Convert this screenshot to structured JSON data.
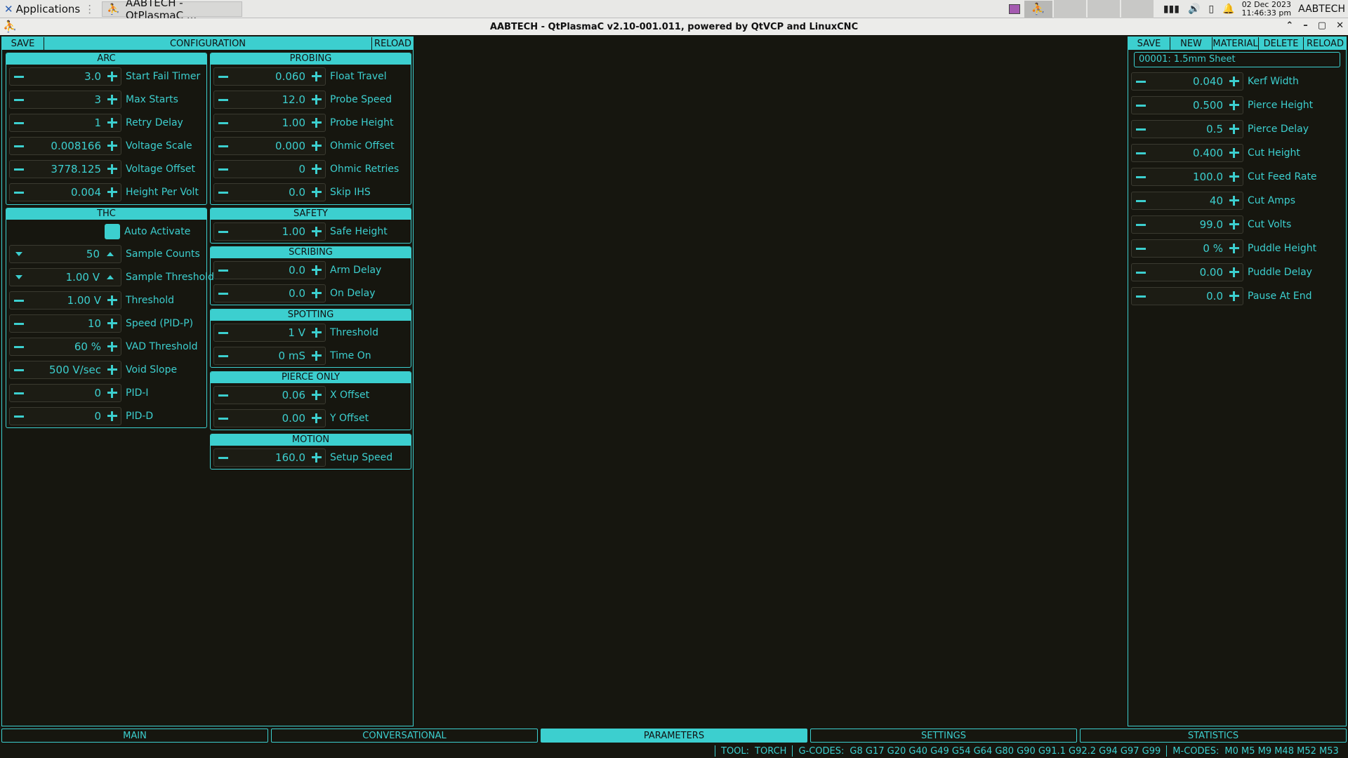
{
  "taskbar": {
    "applications": "Applications",
    "window_title": "AABTECH - QtPlasmaC ...",
    "date": "02 Dec 2023",
    "time": "11:46:33 pm",
    "user": "AABTECH"
  },
  "window": {
    "title": "AABTECH - QtPlasmaC v2.10-001.011, powered by QtVCP and LinuxCNC"
  },
  "config": {
    "save": "SAVE",
    "title": "CONFIGURATION",
    "reload": "RELOAD",
    "arc": {
      "title": "ARC",
      "rows": [
        {
          "value": "3.0",
          "label": "Start Fail Timer"
        },
        {
          "value": "3",
          "label": "Max Starts"
        },
        {
          "value": "1",
          "label": "Retry Delay"
        },
        {
          "value": "0.008166",
          "label": "Voltage Scale"
        },
        {
          "value": "3778.125",
          "label": "Voltage Offset"
        },
        {
          "value": "0.004",
          "label": "Height Per Volt"
        }
      ]
    },
    "thc": {
      "title": "THC",
      "auto_activate": "Auto Activate",
      "rows": [
        {
          "value": "50",
          "label": "Sample Counts"
        },
        {
          "value": "1.00 V",
          "label": "Sample Threshold"
        },
        {
          "value": "1.00 V",
          "label": "Threshold"
        },
        {
          "value": "10",
          "label": "Speed (PID-P)"
        },
        {
          "value": "60 %",
          "label": "VAD Threshold"
        },
        {
          "value": "500 V/sec",
          "label": "Void Slope"
        },
        {
          "value": "0",
          "label": "PID-I"
        },
        {
          "value": "0",
          "label": "PID-D"
        }
      ]
    },
    "probing": {
      "title": "PROBING",
      "rows": [
        {
          "value": "0.060",
          "label": "Float Travel"
        },
        {
          "value": "12.0",
          "label": "Probe Speed"
        },
        {
          "value": "1.00",
          "label": "Probe Height"
        },
        {
          "value": "0.000",
          "label": "Ohmic Offset"
        },
        {
          "value": "0",
          "label": "Ohmic Retries"
        },
        {
          "value": "0.0",
          "label": "Skip IHS"
        }
      ]
    },
    "safety": {
      "title": "SAFETY",
      "rows": [
        {
          "value": "1.00",
          "label": "Safe Height"
        }
      ]
    },
    "scribing": {
      "title": "SCRIBING",
      "rows": [
        {
          "value": "0.0",
          "label": "Arm Delay"
        },
        {
          "value": "0.0",
          "label": "On Delay"
        }
      ]
    },
    "spotting": {
      "title": "SPOTTING",
      "rows": [
        {
          "value": "1 V",
          "label": "Threshold"
        },
        {
          "value": "0 mS",
          "label": "Time On"
        }
      ]
    },
    "pierce_only": {
      "title": "PIERCE ONLY",
      "rows": [
        {
          "value": "0.06",
          "label": "X Offset"
        },
        {
          "value": "0.00",
          "label": "Y Offset"
        }
      ]
    },
    "motion": {
      "title": "MOTION",
      "rows": [
        {
          "value": "160.0",
          "label": "Setup Speed"
        }
      ]
    }
  },
  "material": {
    "save": "SAVE",
    "new": "NEW",
    "material": "MATERIAL",
    "delete": "DELETE",
    "reload": "RELOAD",
    "selected": "00001: 1.5mm Sheet",
    "rows": [
      {
        "value": "0.040",
        "label": "Kerf Width"
      },
      {
        "value": "0.500",
        "label": "Pierce Height"
      },
      {
        "value": "0.5",
        "label": "Pierce Delay"
      },
      {
        "value": "0.400",
        "label": "Cut Height"
      },
      {
        "value": "100.0",
        "label": "Cut Feed Rate"
      },
      {
        "value": "40",
        "label": "Cut Amps"
      },
      {
        "value": "99.0",
        "label": "Cut Volts"
      },
      {
        "value": "0 %",
        "label": "Puddle Height"
      },
      {
        "value": "0.00",
        "label": "Puddle Delay"
      },
      {
        "value": "0.0",
        "label": "Pause At End"
      }
    ]
  },
  "tabs": [
    "MAIN",
    "CONVERSATIONAL",
    "PARAMETERS",
    "SETTINGS",
    "STATISTICS"
  ],
  "status": {
    "tool_label": "TOOL:",
    "tool": "TORCH",
    "gcodes_label": "G-CODES:",
    "gcodes": "G8 G17 G20 G40 G49 G54 G64 G80 G90 G91.1 G92.2 G94 G97 G99",
    "mcodes_label": "M-CODES:",
    "mcodes": "M0 M5 M9 M48 M52 M53"
  }
}
